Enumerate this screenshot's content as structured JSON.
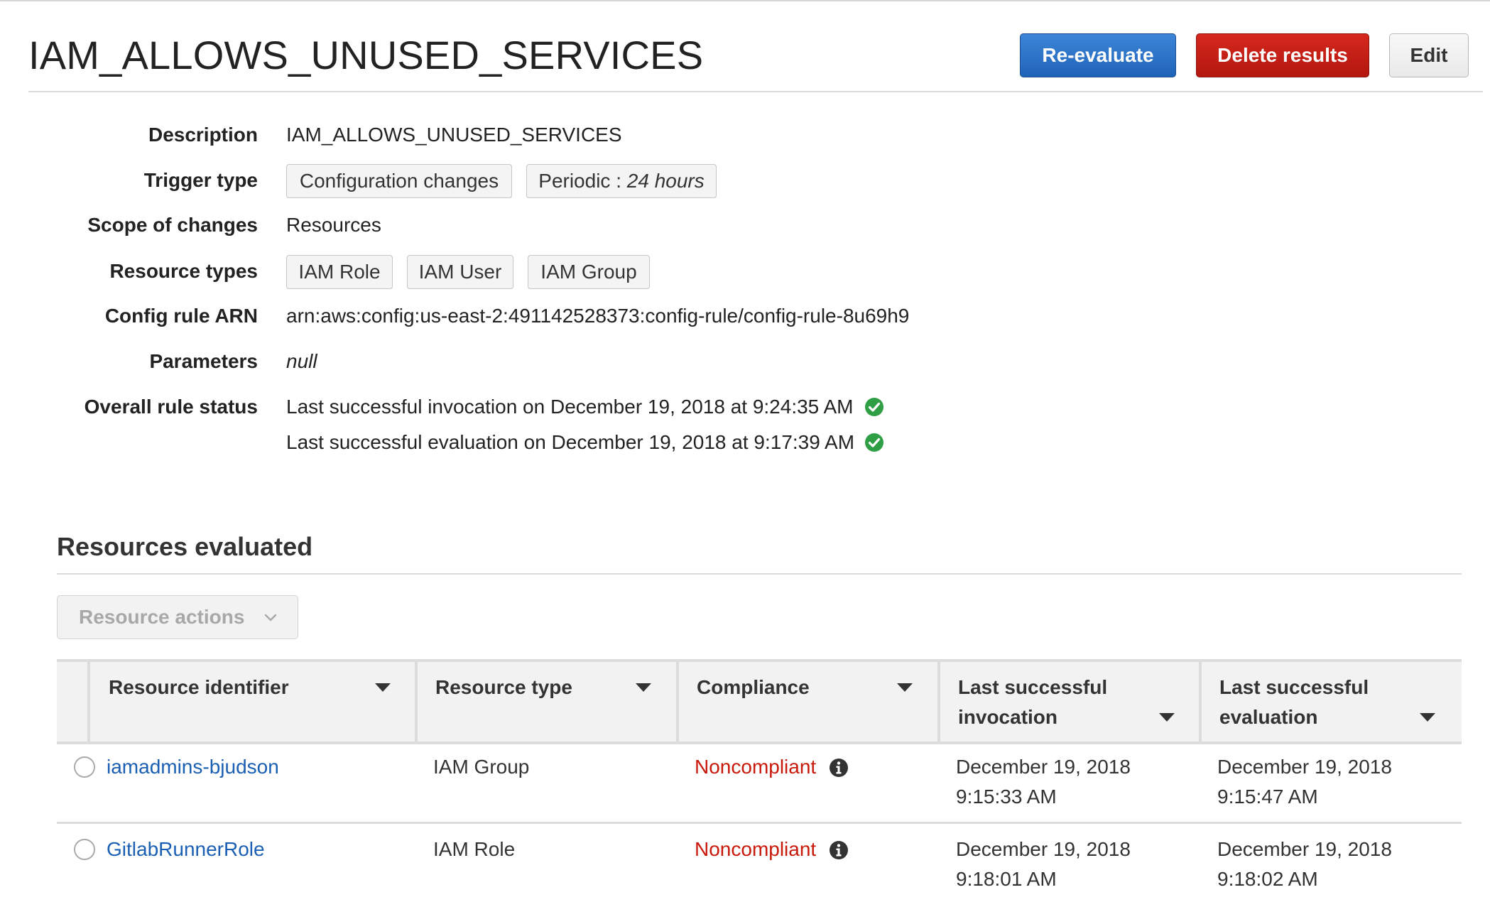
{
  "page": {
    "title": "IAM_ALLOWS_UNUSED_SERVICES"
  },
  "actions": {
    "reevaluate": "Re-evaluate",
    "delete": "Delete results",
    "edit": "Edit"
  },
  "details": {
    "description_label": "Description",
    "description": "IAM_ALLOWS_UNUSED_SERVICES",
    "trigger_label": "Trigger type",
    "trigger_config": "Configuration changes",
    "trigger_periodic_prefix": "Periodic : ",
    "trigger_periodic_value": "24 hours",
    "scope_label": "Scope of changes",
    "scope": "Resources",
    "resource_types_label": "Resource types",
    "resource_types": [
      "IAM Role",
      "IAM User",
      "IAM Group"
    ],
    "arn_label": "Config rule ARN",
    "arn": "arn:aws:config:us-east-2:491142528373:config-rule/config-rule-8u69h9",
    "parameters_label": "Parameters",
    "parameters": "null",
    "status_label": "Overall rule status",
    "status_invocation": "Last successful invocation on December 19, 2018 at 9:24:35 AM",
    "status_evaluation": "Last successful evaluation on December 19, 2018 at 9:17:39 AM"
  },
  "resources": {
    "title": "Resources evaluated",
    "actions_label": "Resource actions",
    "columns": {
      "identifier": "Resource identifier",
      "type": "Resource type",
      "compliance": "Compliance",
      "invocation_l1": "Last successful",
      "invocation_l2": "invocation",
      "evaluation_l1": "Last successful",
      "evaluation_l2": "evaluation"
    },
    "rows": [
      {
        "id": "iamadmins-bjudson",
        "type": "IAM Group",
        "compliance": "Noncompliant",
        "invocation_date": "December 19, 2018",
        "invocation_time": "9:15:33 AM",
        "evaluation_date": "December 19, 2018",
        "evaluation_time": "9:15:47 AM"
      },
      {
        "id": "GitlabRunnerRole",
        "type": "IAM Role",
        "compliance": "Noncompliant",
        "invocation_date": "December 19, 2018",
        "invocation_time": "9:18:01 AM",
        "evaluation_date": "December 19, 2018",
        "evaluation_time": "9:18:02 AM"
      }
    ]
  },
  "colors": {
    "primary": "#2a70c6",
    "danger": "#c51f15",
    "success": "#2f9e44",
    "noncompliant": "#c9190b",
    "link": "#1a5fb4"
  }
}
